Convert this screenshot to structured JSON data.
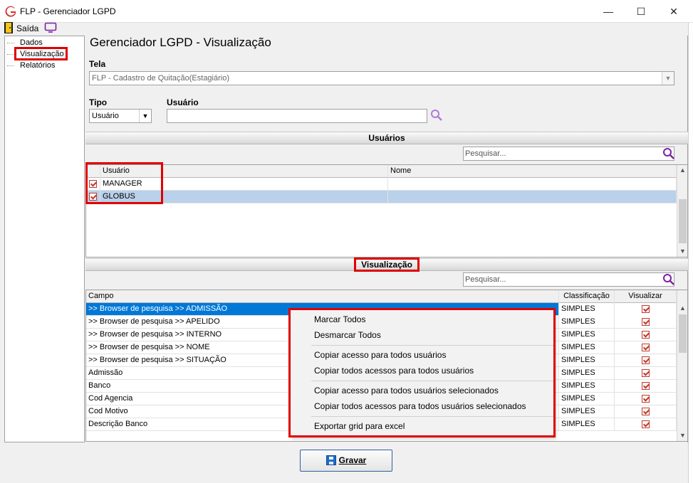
{
  "window": {
    "title": "FLP - Gerenciador LGPD",
    "app_icon": "g-logo-icon",
    "controls": {
      "minimize": "—",
      "maximize": "☐",
      "close": "✕"
    }
  },
  "menu": {
    "saida_label": "Saída",
    "saida_icon": "exit-door-icon",
    "monitor_icon": "monitor-icon"
  },
  "tree": {
    "items": [
      {
        "label": "Dados"
      },
      {
        "label": "Visualização",
        "selected": true
      },
      {
        "label": "Relatórios"
      }
    ]
  },
  "page": {
    "title": "Gerenciador LGPD - Visualização",
    "tela_label": "Tela",
    "tela_value": "FLP - Cadastro de Quitação(Estagiário)",
    "tipo_label": "Tipo",
    "tipo_value": "Usuário",
    "usuario_label": "Usuário",
    "usuario_value": ""
  },
  "usuarios_section": {
    "title": "Usuários",
    "search_placeholder": "Pesquisar...",
    "columns": [
      "Usuário",
      "Nome"
    ],
    "rows": [
      {
        "checked": true,
        "usuario": "MANAGER",
        "nome": ""
      },
      {
        "checked": true,
        "usuario": "GLOBUS",
        "nome": "",
        "selected": true
      }
    ]
  },
  "visualizacao_section": {
    "title": "Visualização",
    "search_placeholder": "Pesquisar...",
    "columns": [
      "Campo",
      "Classificação",
      "Visualizar"
    ],
    "rows": [
      {
        "campo": ">> Browser de pesquisa >> ADMISSÃO",
        "classificacao": "SIMPLES",
        "visualizar": true,
        "selected": true
      },
      {
        "campo": ">> Browser de pesquisa >> APELIDO",
        "classificacao": "SIMPLES",
        "visualizar": true
      },
      {
        "campo": ">> Browser de pesquisa >> INTERNO",
        "classificacao": "SIMPLES",
        "visualizar": true
      },
      {
        "campo": ">> Browser de pesquisa >> NOME",
        "classificacao": "SIMPLES",
        "visualizar": true
      },
      {
        "campo": ">> Browser de pesquisa >> SITUAÇÃO",
        "classificacao": "SIMPLES",
        "visualizar": true
      },
      {
        "campo": "Admissão",
        "classificacao": "SIMPLES",
        "visualizar": true
      },
      {
        "campo": "Banco",
        "classificacao": "SIMPLES",
        "visualizar": true
      },
      {
        "campo": "Cod Agencia",
        "classificacao": "SIMPLES",
        "visualizar": true
      },
      {
        "campo": "Cod Motivo",
        "classificacao": "SIMPLES",
        "visualizar": true
      },
      {
        "campo": "Descrição Banco",
        "classificacao": "SIMPLES",
        "visualizar": true
      }
    ]
  },
  "context_menu": {
    "items": [
      "Marcar Todos",
      "Desmarcar Todos",
      "Copiar acesso para todos usuários",
      "Copiar todos acessos para todos usuários",
      "Copiar acesso para todos usuários selecionados",
      "Copiar todos acessos para todos usuários selecionados",
      "Exportar grid para excel"
    ]
  },
  "footer": {
    "save_label": "Gravar",
    "save_icon": "floppy-disk-icon"
  },
  "colors": {
    "selection": "#0078d7",
    "annotation_red": "#e00000",
    "checkbox_red": "#c0392b"
  }
}
